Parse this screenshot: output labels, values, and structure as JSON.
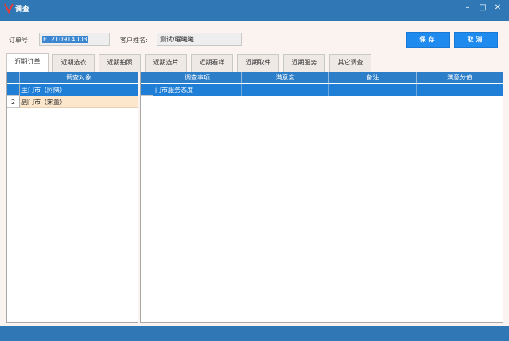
{
  "window": {
    "title": "调查",
    "minimize_glyph": "–",
    "maximize_glyph": "□",
    "close_glyph": "✕"
  },
  "form": {
    "order_label": "订单号:",
    "order_value": "ET210914003",
    "customer_label": "客户姓名:",
    "customer_value": "测试/曜曦曦"
  },
  "buttons": {
    "save": "保存",
    "cancel": "取消"
  },
  "tabs": [
    {
      "label": "近期订单",
      "active": true
    },
    {
      "label": "近期选衣",
      "active": false
    },
    {
      "label": "近期拍照",
      "active": false
    },
    {
      "label": "近期选片",
      "active": false
    },
    {
      "label": "近期看样",
      "active": false
    },
    {
      "label": "近期取件",
      "active": false
    },
    {
      "label": "近期服务",
      "active": false
    },
    {
      "label": "其它调查",
      "active": false
    }
  ],
  "left_grid": {
    "columns": [
      "调查对象"
    ],
    "rows": [
      {
        "num": "1",
        "cells": [
          "主门市（阿陕）"
        ],
        "selected": true
      },
      {
        "num": "2",
        "cells": [
          "副门市（宋董）"
        ],
        "selected": false
      }
    ]
  },
  "right_grid": {
    "columns": [
      "调查事项",
      "满意度",
      "备注",
      "满意分值"
    ],
    "rows": [
      {
        "num": "1",
        "cells": [
          "门市服务态度",
          "",
          "",
          ""
        ],
        "selected": true
      }
    ]
  },
  "colors": {
    "titlebar": "#2f78b5",
    "accent_button": "#1f8bef",
    "header": "#2c7ec8",
    "selected_row": "#1f7fd6",
    "left_highlight_row": "#fde7cc"
  }
}
